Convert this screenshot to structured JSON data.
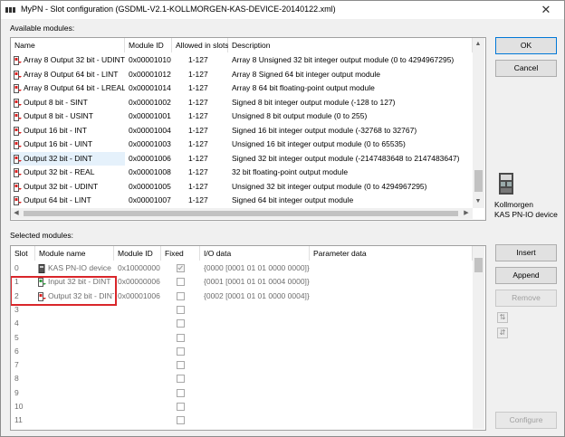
{
  "window": {
    "title": "MyPN - Slot configuration (GSDML-V2.1-KOLLMORGEN-KAS-DEVICE-20140122.xml)",
    "close_glyph": "✕"
  },
  "available": {
    "label": "Available modules:",
    "headers": [
      "Name",
      "Module ID",
      "Allowed in slots",
      "Description"
    ],
    "rows": [
      {
        "name": "Array 8 Output 32 bit - UDINT",
        "id": "0x00001010",
        "slots": "1-127",
        "desc": "Array 8 Unsigned 32 bit integer output module (0 to 4294967295)"
      },
      {
        "name": "Array 8 Output 64 bit - LINT",
        "id": "0x00001012",
        "slots": "1-127",
        "desc": "Array 8 Signed 64 bit integer output module"
      },
      {
        "name": "Array 8 Output 64 bit - LREAL",
        "id": "0x00001014",
        "slots": "1-127",
        "desc": "Array 8 64 bit floating-point output module"
      },
      {
        "name": "Output  8 bit - SINT",
        "id": "0x00001002",
        "slots": "1-127",
        "desc": "Signed 8 bit integer output module (-128 to 127)"
      },
      {
        "name": "Output  8 bit - USINT",
        "id": "0x00001001",
        "slots": "1-127",
        "desc": "Unsigned 8 bit output module (0 to 255)"
      },
      {
        "name": "Output 16 bit - INT",
        "id": "0x00001004",
        "slots": "1-127",
        "desc": "Signed 16 bit integer output module (-32768 to 32767)"
      },
      {
        "name": "Output 16 bit - UINT",
        "id": "0x00001003",
        "slots": "1-127",
        "desc": "Unsigned 16 bit integer output module (0 to 65535)"
      },
      {
        "name": "Output 32 bit - DINT",
        "id": "0x00001006",
        "slots": "1-127",
        "desc": "Signed 32 bit integer output module (-2147483648 to 2147483647)"
      },
      {
        "name": "Output 32 bit - REAL",
        "id": "0x00001008",
        "slots": "1-127",
        "desc": "32 bit floating-point output module"
      },
      {
        "name": "Output 32 bit - UDINT",
        "id": "0x00001005",
        "slots": "1-127",
        "desc": "Unsigned 32 bit integer output module (0 to 4294967295)"
      },
      {
        "name": "Output 64 bit - LINT",
        "id": "0x00001007",
        "slots": "1-127",
        "desc": "Signed 64 bit integer output module"
      }
    ]
  },
  "selected": {
    "label": "Selected modules:",
    "headers": [
      "Slot",
      "Module name",
      "Module ID",
      "Fixed",
      "I/O data",
      "Parameter data"
    ],
    "rows": [
      {
        "slot": "0",
        "name": "KAS PN-IO device",
        "id": "0x10000000",
        "fixed": true,
        "io": "{0000 [0001 01 01 0000 0000]}",
        "param": ""
      },
      {
        "slot": "1",
        "name": "Input 32 bit - DINT",
        "id": "0x00000006",
        "fixed": false,
        "io": "{0001 [0001 01 01 0004 0000]}",
        "param": ""
      },
      {
        "slot": "2",
        "name": "Output 32 bit - DINT",
        "id": "0x00001006",
        "fixed": false,
        "io": "{0002 [0001 01 01 0000 0004]}",
        "param": ""
      },
      {
        "slot": "3",
        "name": "",
        "id": "",
        "fixed": false,
        "io": "",
        "param": ""
      },
      {
        "slot": "4",
        "name": "",
        "id": "",
        "fixed": false,
        "io": "",
        "param": ""
      },
      {
        "slot": "5",
        "name": "",
        "id": "",
        "fixed": false,
        "io": "",
        "param": ""
      },
      {
        "slot": "6",
        "name": "",
        "id": "",
        "fixed": false,
        "io": "",
        "param": ""
      },
      {
        "slot": "7",
        "name": "",
        "id": "",
        "fixed": false,
        "io": "",
        "param": ""
      },
      {
        "slot": "8",
        "name": "",
        "id": "",
        "fixed": false,
        "io": "",
        "param": ""
      },
      {
        "slot": "9",
        "name": "",
        "id": "",
        "fixed": false,
        "io": "",
        "param": ""
      },
      {
        "slot": "10",
        "name": "",
        "id": "",
        "fixed": false,
        "io": "",
        "param": ""
      },
      {
        "slot": "11",
        "name": "",
        "id": "",
        "fixed": false,
        "io": "",
        "param": ""
      }
    ]
  },
  "buttons": {
    "ok": "OK",
    "cancel": "Cancel",
    "insert": "Insert",
    "append": "Append",
    "remove": "Remove",
    "configure": "Configure",
    "move_up": "⇅",
    "move_down": "⇵"
  },
  "device": {
    "line1": "Kollmorgen",
    "line2": "KAS PN-IO device"
  },
  "colors": {
    "selection": "#e5f1fb",
    "highlight_box": "#d9262a",
    "default_button_border": "#0078d7"
  }
}
